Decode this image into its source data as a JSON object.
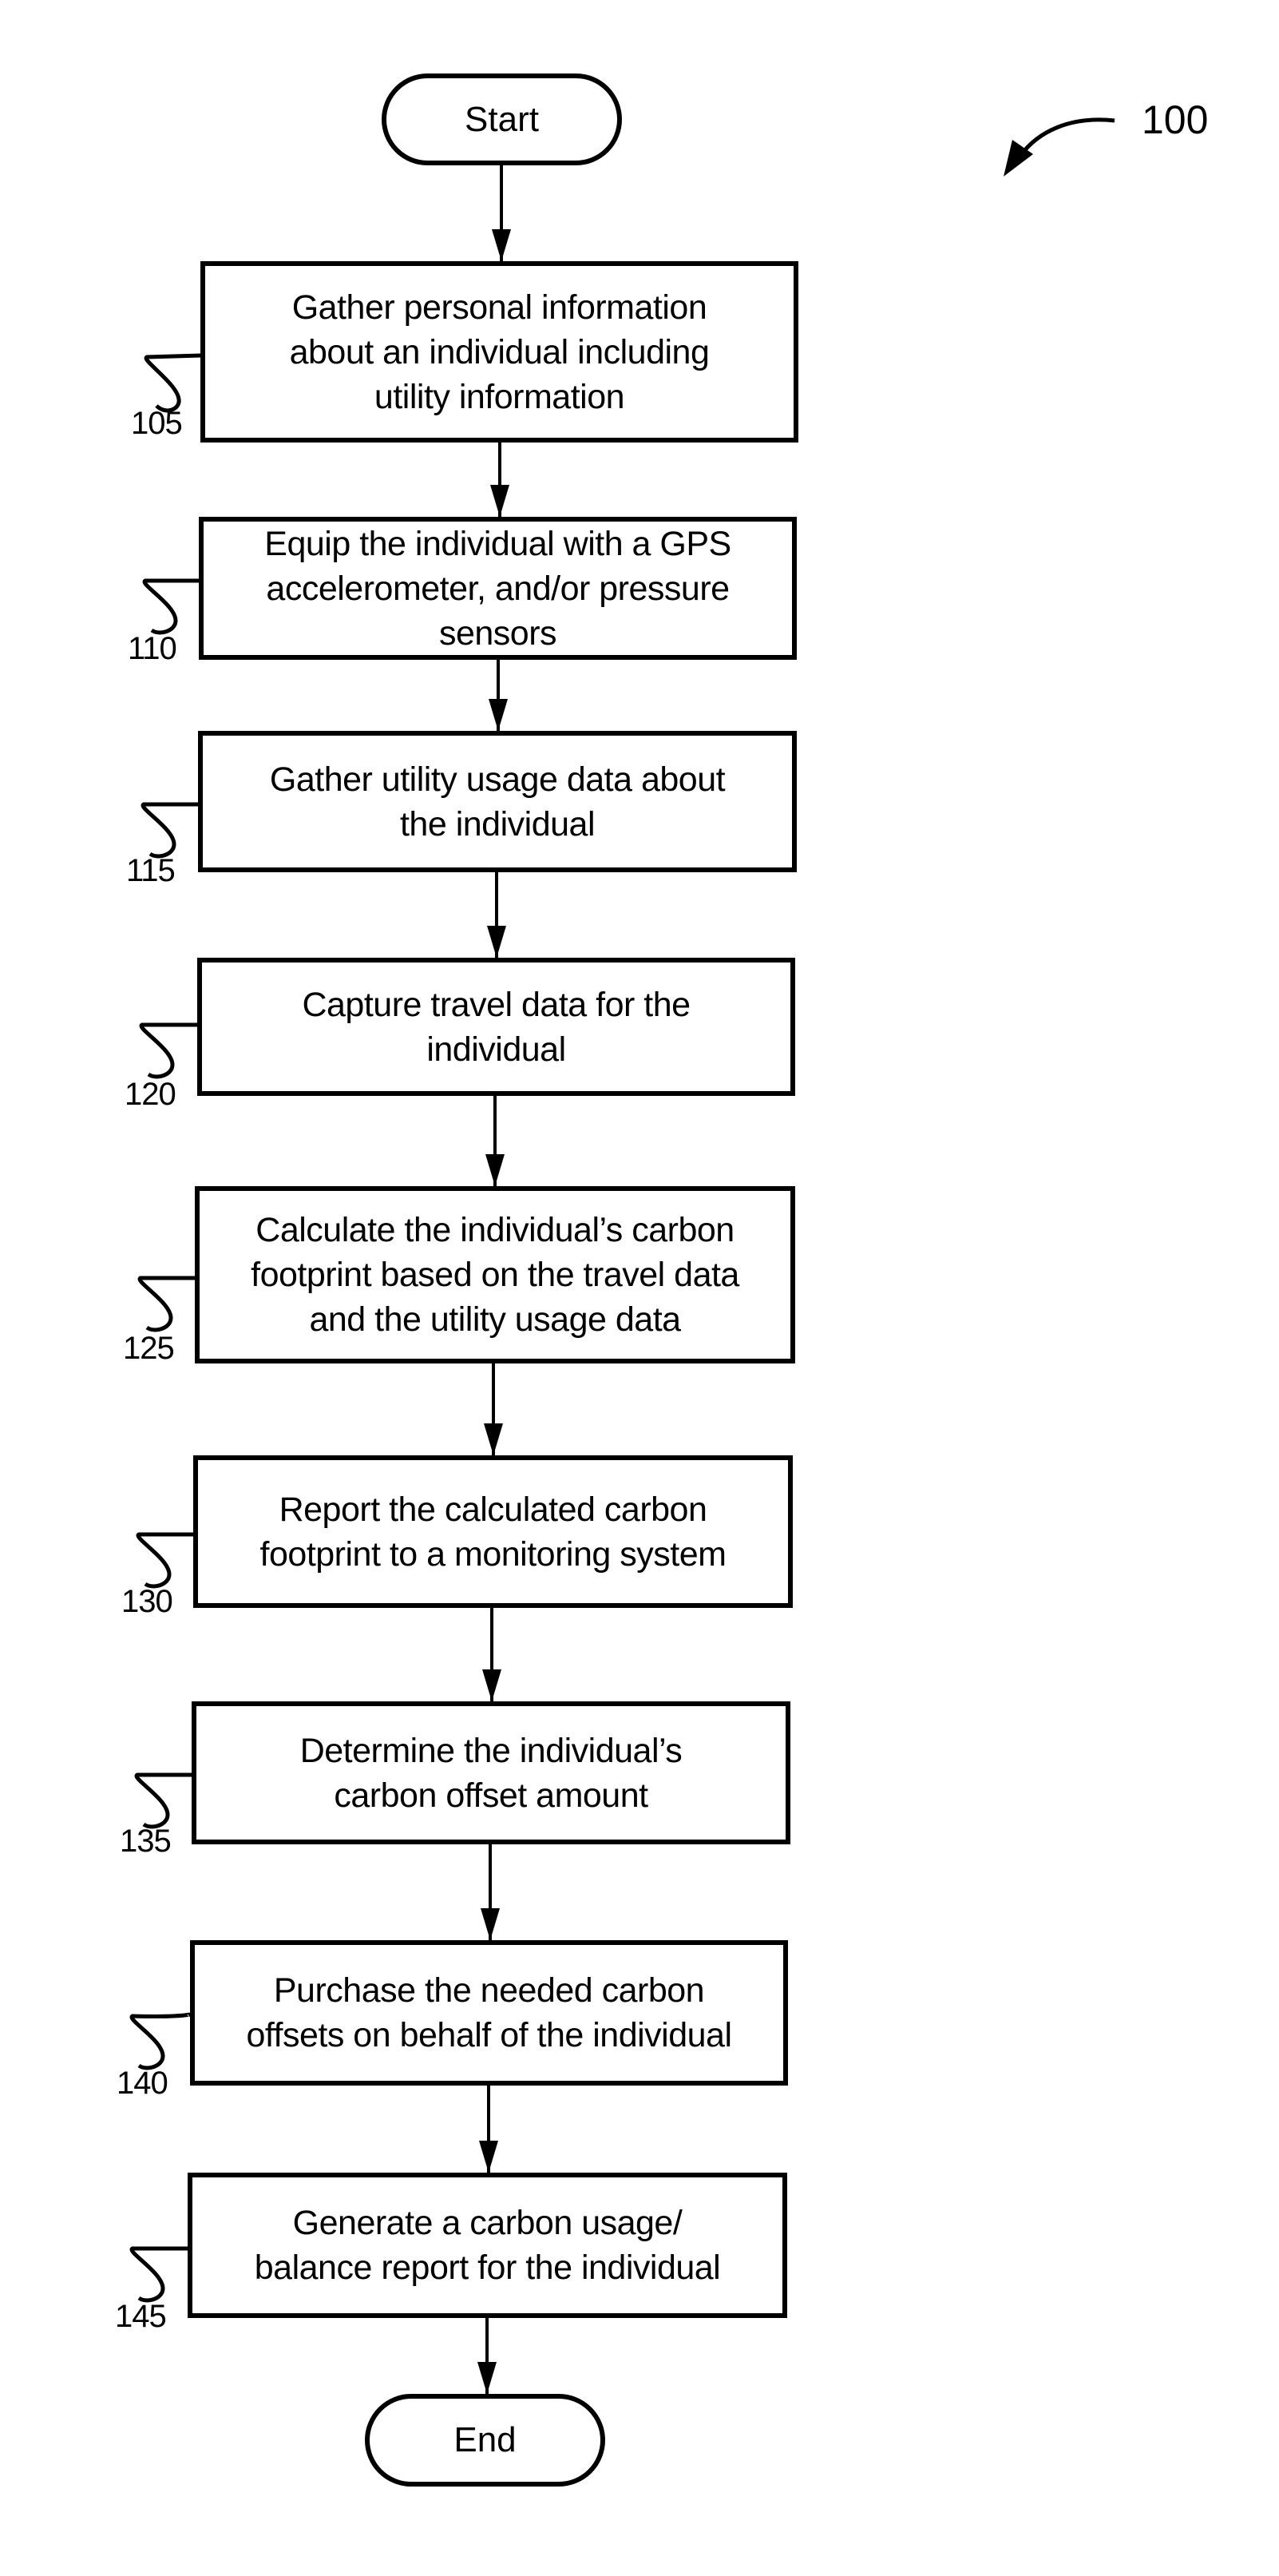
{
  "figure": {
    "reference_numeral": "100"
  },
  "start": {
    "label": "Start"
  },
  "end": {
    "label": "End"
  },
  "steps": [
    {
      "ref": "105",
      "text": "Gather personal information\nabout an individual including\nutility information"
    },
    {
      "ref": "110",
      "text": "Equip the individual with a GPS\naccelerometer, and/or pressure\nsensors"
    },
    {
      "ref": "115",
      "text": "Gather utility usage data about\nthe individual"
    },
    {
      "ref": "120",
      "text": "Capture travel data for the\nindividual"
    },
    {
      "ref": "125",
      "text": "Calculate the individual’s carbon\nfootprint based on the travel data\nand the utility usage data"
    },
    {
      "ref": "130",
      "text": "Report the calculated carbon\nfootprint to a monitoring system"
    },
    {
      "ref": "135",
      "text": "Determine the individual’s\ncarbon offset amount"
    },
    {
      "ref": "140",
      "text": "Purchase the needed carbon\noffsets on behalf of the individual"
    },
    {
      "ref": "145",
      "text": "Generate a carbon usage/\nbalance report for the individual"
    }
  ]
}
